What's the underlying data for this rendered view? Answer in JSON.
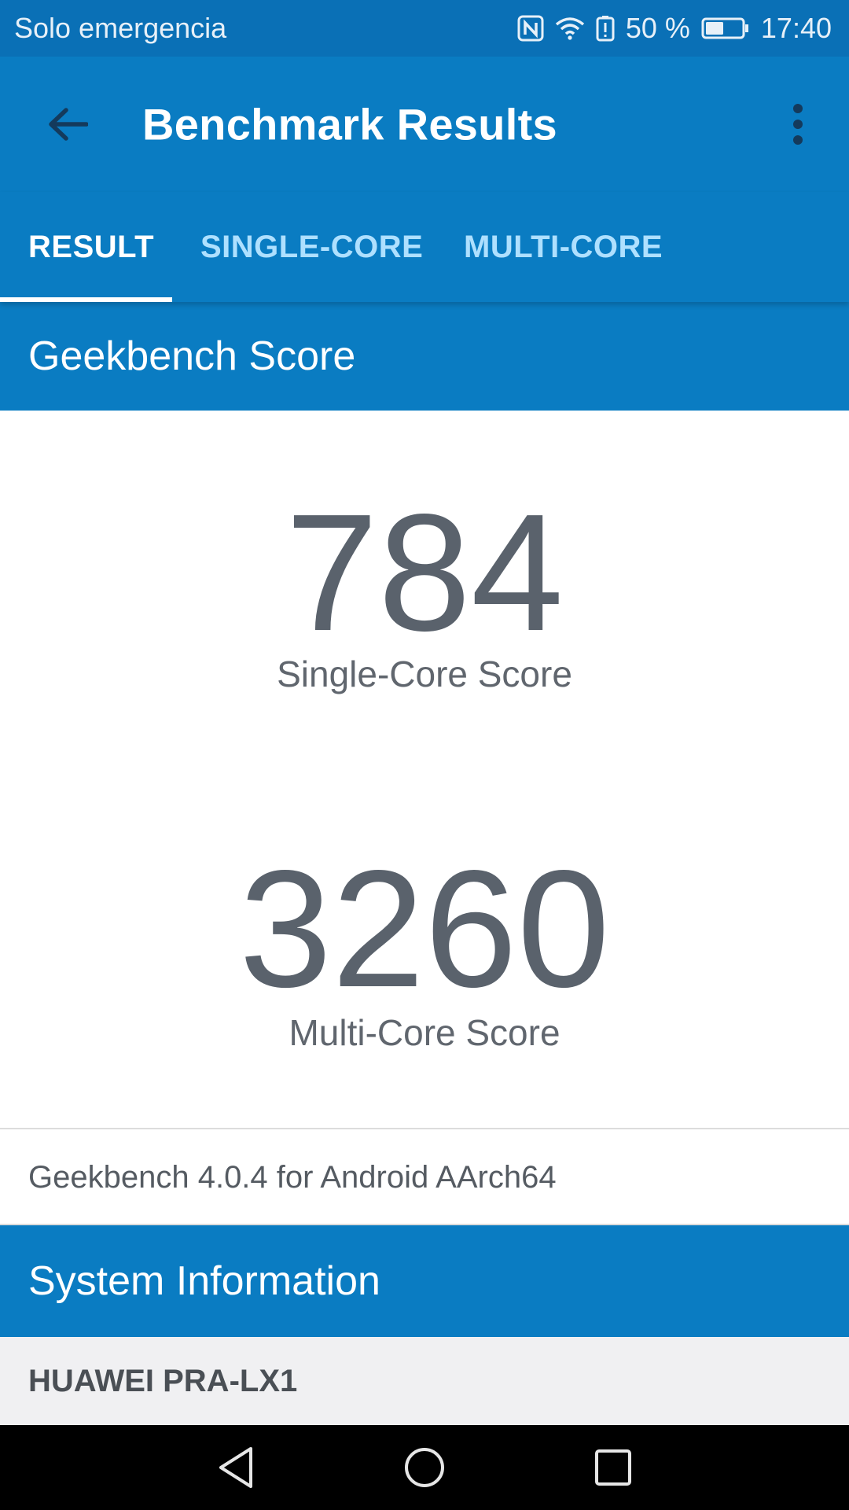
{
  "status_bar": {
    "carrier": "Solo emergencia",
    "battery_percent": "50 %",
    "battery_level": 0.5,
    "time": "17:40"
  },
  "app_bar": {
    "title": "Benchmark Results"
  },
  "tabs": [
    {
      "label": "RESULT",
      "active": true
    },
    {
      "label": "SINGLE-CORE",
      "active": false
    },
    {
      "label": "MULTI-CORE",
      "active": false
    }
  ],
  "geekbench": {
    "header": "Geekbench Score",
    "single_core_score": "784",
    "single_core_label": "Single-Core Score",
    "multi_core_score": "3260",
    "multi_core_label": "Multi-Core Score",
    "version": "Geekbench 4.0.4 for Android AArch64"
  },
  "system_info": {
    "header": "System Information",
    "device": "HUAWEI PRA-LX1"
  },
  "colors": {
    "primary": "#0a7cc2",
    "status_bar": "#0a70b6",
    "score_text": "#5a626c",
    "tab_inactive": "#aee0ff"
  },
  "icons": {
    "back": "arrow-back-icon",
    "overflow": "more-vert-icon",
    "nav_back": "triangle-back-icon",
    "nav_home": "circle-home-icon",
    "nav_recents": "square-recents-icon"
  }
}
